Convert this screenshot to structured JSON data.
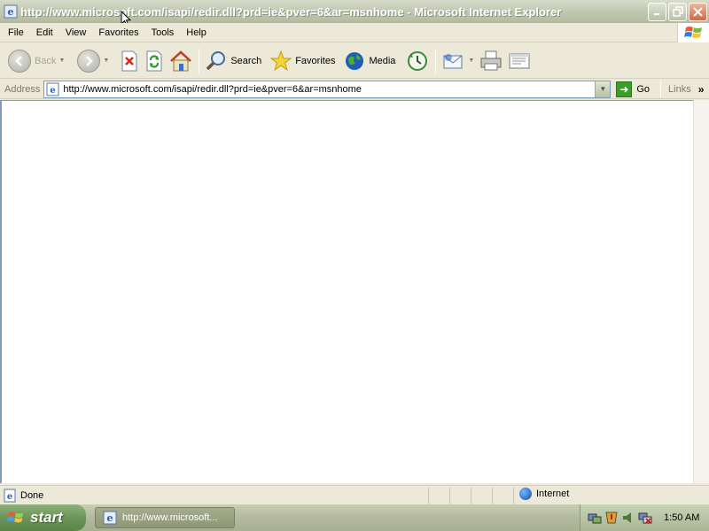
{
  "window": {
    "title": "http://www.microsoft.com/isapi/redir.dll?prd=ie&pver=6&ar=msnhome - Microsoft Internet Explorer",
    "buttons": {
      "minimize": "_",
      "maximize": "□",
      "close": "✕"
    }
  },
  "menu": {
    "file": "File",
    "edit": "Edit",
    "view": "View",
    "favorites": "Favorites",
    "tools": "Tools",
    "help": "Help"
  },
  "toolbar": {
    "back_label": "Back",
    "search_label": "Search",
    "favorites_label": "Favorites",
    "media_label": "Media",
    "icons": [
      "back-icon",
      "forward-icon",
      "stop-icon",
      "refresh-icon",
      "home-icon",
      "search-icon",
      "favorites-star-icon",
      "media-icon",
      "history-icon",
      "mail-icon",
      "print-icon",
      "edit-icon"
    ]
  },
  "address": {
    "label": "Address",
    "url": "http://www.microsoft.com/isapi/redir.dll?prd=ie&pver=6&ar=msnhome",
    "go_label": "Go",
    "links_label": "Links",
    "chevron": "»"
  },
  "status": {
    "text": "Done",
    "zone": "Internet"
  },
  "taskbar": {
    "start_label": "start",
    "task_label": "http://www.microsoft...",
    "clock": "1:50 AM"
  },
  "colors": {
    "titlebar": "#c3c9b2",
    "chrome": "#ece9d8",
    "taskbar": "#b3b99c",
    "start_button": "#6b9658"
  }
}
